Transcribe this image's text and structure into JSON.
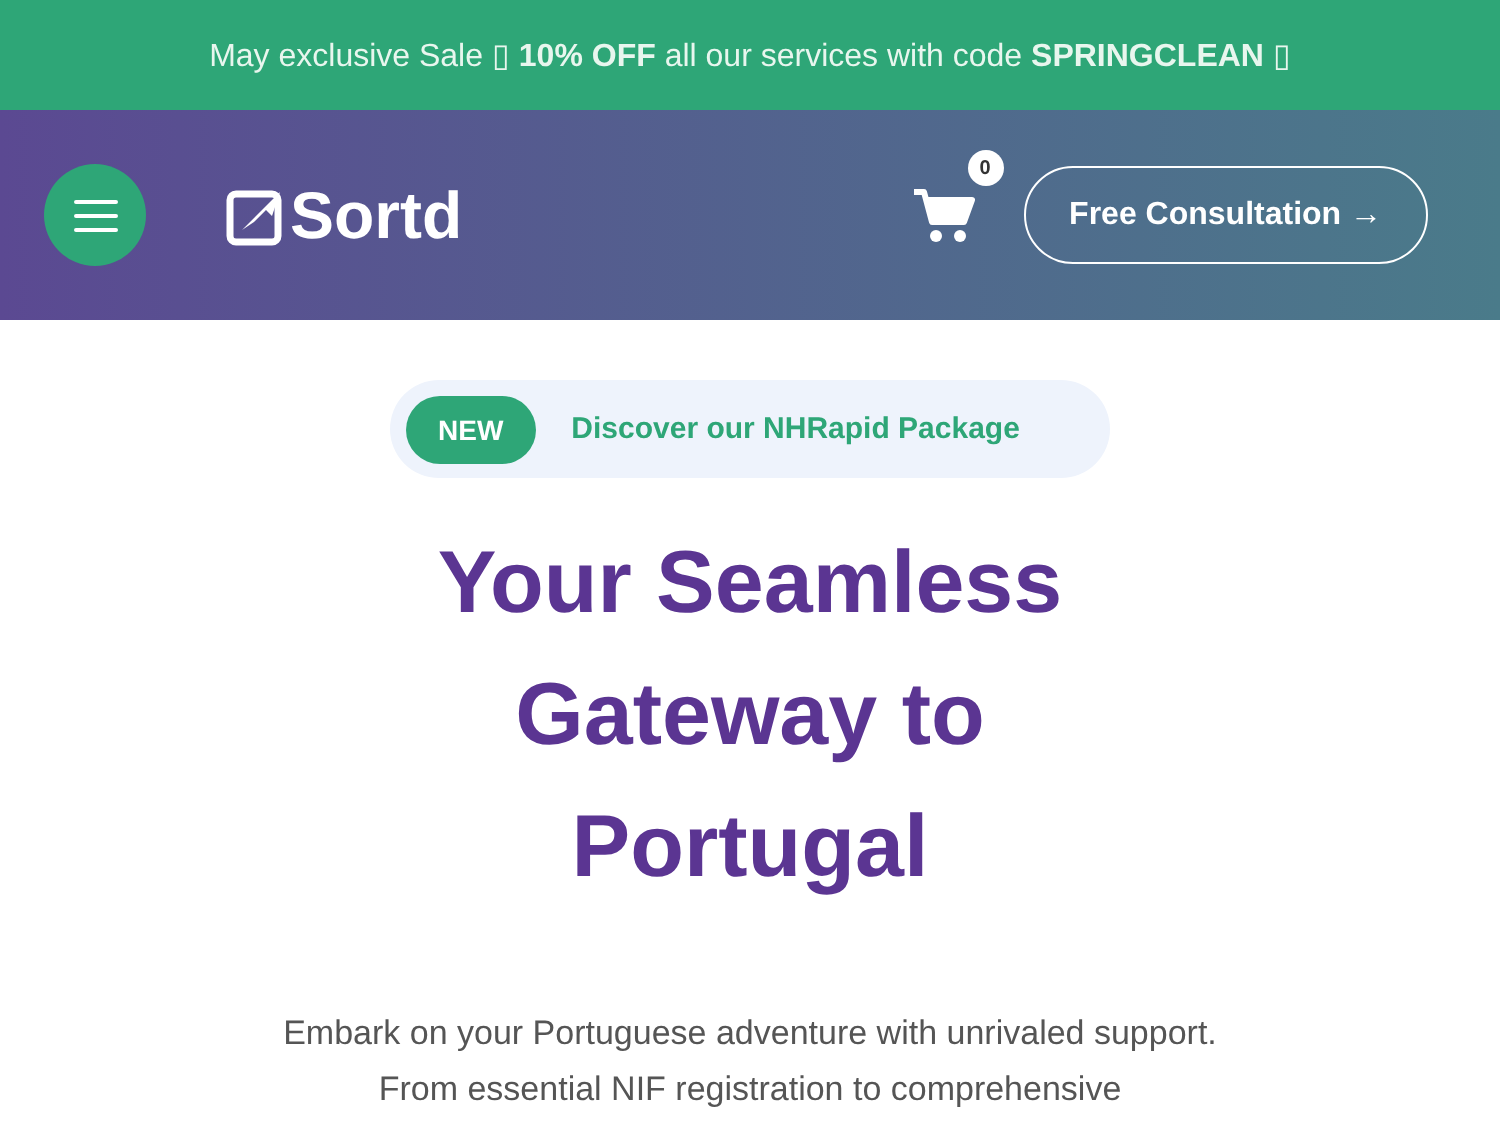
{
  "promo_bar": {
    "text": "May exclusive Sale ▯ **10% OFF** all our services with code **SPRINGCLEAN** ▯"
  },
  "header": {
    "logo": "Sortd",
    "cart_count": "0",
    "cta_button": "Free Consultation →"
  },
  "hero": {
    "badge": "NEW",
    "announcement": "Discover our NHRapid Package",
    "heading": "Your Seamless Gateway to Portugal",
    "paragraph": "Embark on your Portuguese adventure with unrivaled support. From essential NIF registration to comprehensive"
  }
}
